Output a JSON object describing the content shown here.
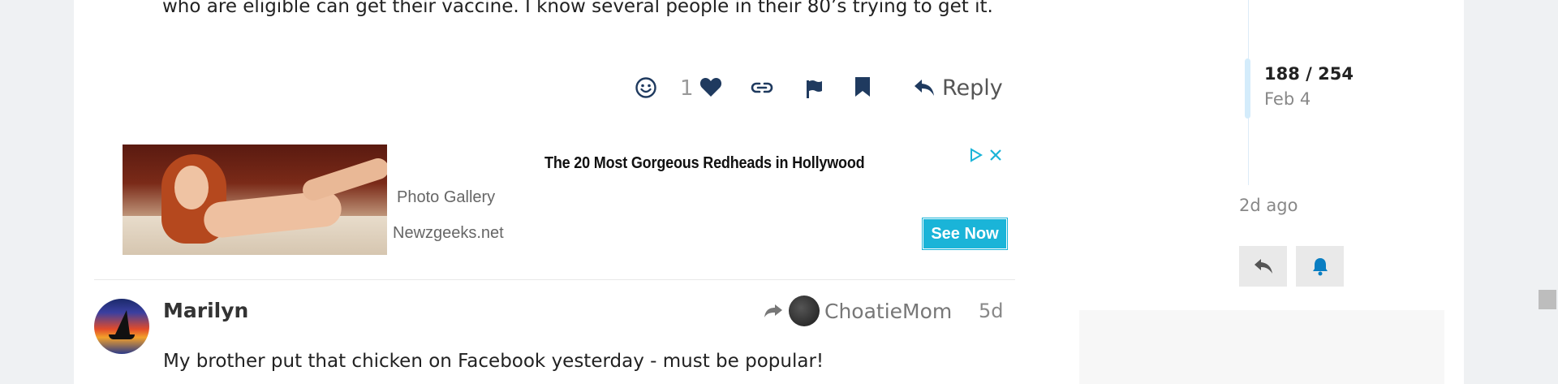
{
  "previous_post": {
    "text_fragment": "who are eligible can get their vaccine. I know several people in their 80’s trying to get it.",
    "actions": {
      "emoji_icon": "smile-icon",
      "like_count": "1",
      "like_icon": "heart-icon",
      "link_icon": "link-icon",
      "flag_icon": "flag-icon",
      "bookmark_icon": "bookmark-icon",
      "reply_label": "Reply"
    }
  },
  "ad": {
    "title": "The 20 Most Gorgeous Redheads in Hollywood",
    "subtitle": "Photo Gallery",
    "site": "Newzgeeks.net",
    "cta": "See Now",
    "accent": "#1ab4d8"
  },
  "post": {
    "username": "Marilyn",
    "reply_to": "ChoatieMom",
    "date": "5d",
    "body": "My brother put that chicken on Facebook yesterday - must be popular!"
  },
  "timeline": {
    "position": "188 / 254",
    "date": "Feb 4",
    "last_activity": "2d ago",
    "accent": "#0a7ec2"
  },
  "colors": {
    "icon_navy": "#1f3a5f",
    "handle": "#d4ecfb"
  }
}
